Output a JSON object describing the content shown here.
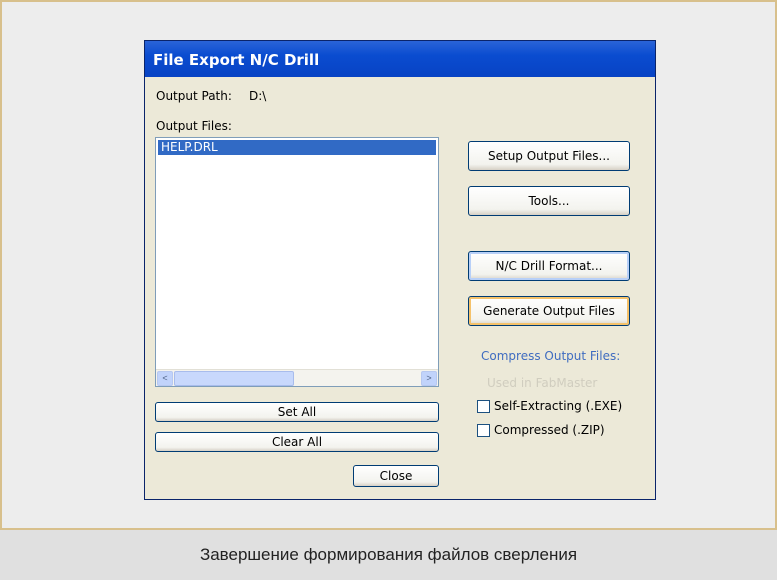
{
  "dialog": {
    "title": "File Export N/C Drill",
    "output_path_label": "Output Path:",
    "output_path_value": "D:\\",
    "output_files_label": "Output Files:",
    "files": [
      "HELP.DRL"
    ],
    "buttons": {
      "setup": "Setup Output Files...",
      "tools": "Tools...",
      "nc_format": "N/C Drill Format...",
      "generate": "Generate Output Files",
      "set_all": "Set All",
      "clear_all": "Clear All",
      "close": "Close"
    },
    "compress_label": "Compress Output Files:",
    "compress_disabled_option": "Used in FabMaster",
    "options": {
      "self_extracting": "Self-Extracting (.EXE)",
      "compressed_zip": "Compressed (.ZIP)"
    },
    "scroll": {
      "left_arrow": "<",
      "right_arrow": ">"
    }
  },
  "caption": "Завершение формирования файлов сверления"
}
